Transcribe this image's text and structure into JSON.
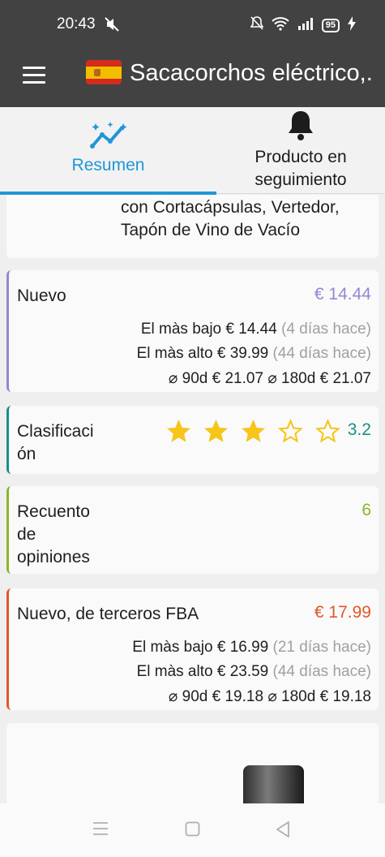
{
  "status": {
    "time": "20:43",
    "battery": "95"
  },
  "appbar": {
    "title": "Sacacorchos eléctrico,."
  },
  "tabs": [
    {
      "label": "Resumen"
    },
    {
      "label_line1": "Producto en",
      "label_line2": "seguimiento"
    }
  ],
  "description": {
    "line1": "con Cortacápsulas, Vertedor,",
    "line2": "Tapón de Vino de Vacío"
  },
  "new": {
    "label": "Nuevo",
    "price": "€ 14.44",
    "lowest_label": "El màs bajo",
    "lowest_price": "€ 14.44",
    "lowest_when": "(4 días hace)",
    "highest_label": "El màs alto",
    "highest_price": "€ 39.99",
    "highest_when": "(44 días hace)",
    "avg90_label": "⌀ 90d",
    "avg90": "€ 21.07",
    "avg180_label": "⌀ 180d",
    "avg180": "€ 21.07"
  },
  "rating": {
    "label_line1": "Clasificaci",
    "label_line2": "ón",
    "value": "3.2",
    "stars": 3,
    "star_color": "#f5c518"
  },
  "reviews": {
    "label_line1": "Recuento",
    "label_line2": "de",
    "label_line3": "opiniones",
    "value": "6"
  },
  "fba": {
    "label": "Nuevo, de terceros FBA",
    "price": "€ 17.99",
    "lowest_label": "El màs bajo",
    "lowest_price": "€ 16.99",
    "lowest_when": "(21 días hace)",
    "highest_label": "El màs alto",
    "highest_price": "€ 23.59",
    "highest_when": "(44 días hace)",
    "avg90_label": "⌀ 90d",
    "avg90": "€ 19.18",
    "avg180_label": "⌀ 180d",
    "avg180": "€ 19.18"
  },
  "colors": {
    "accent": "#2196d8",
    "new": "#9188d4",
    "rating": "#1a8f82",
    "reviews": "#8ab52c",
    "fba": "#e0572a"
  }
}
